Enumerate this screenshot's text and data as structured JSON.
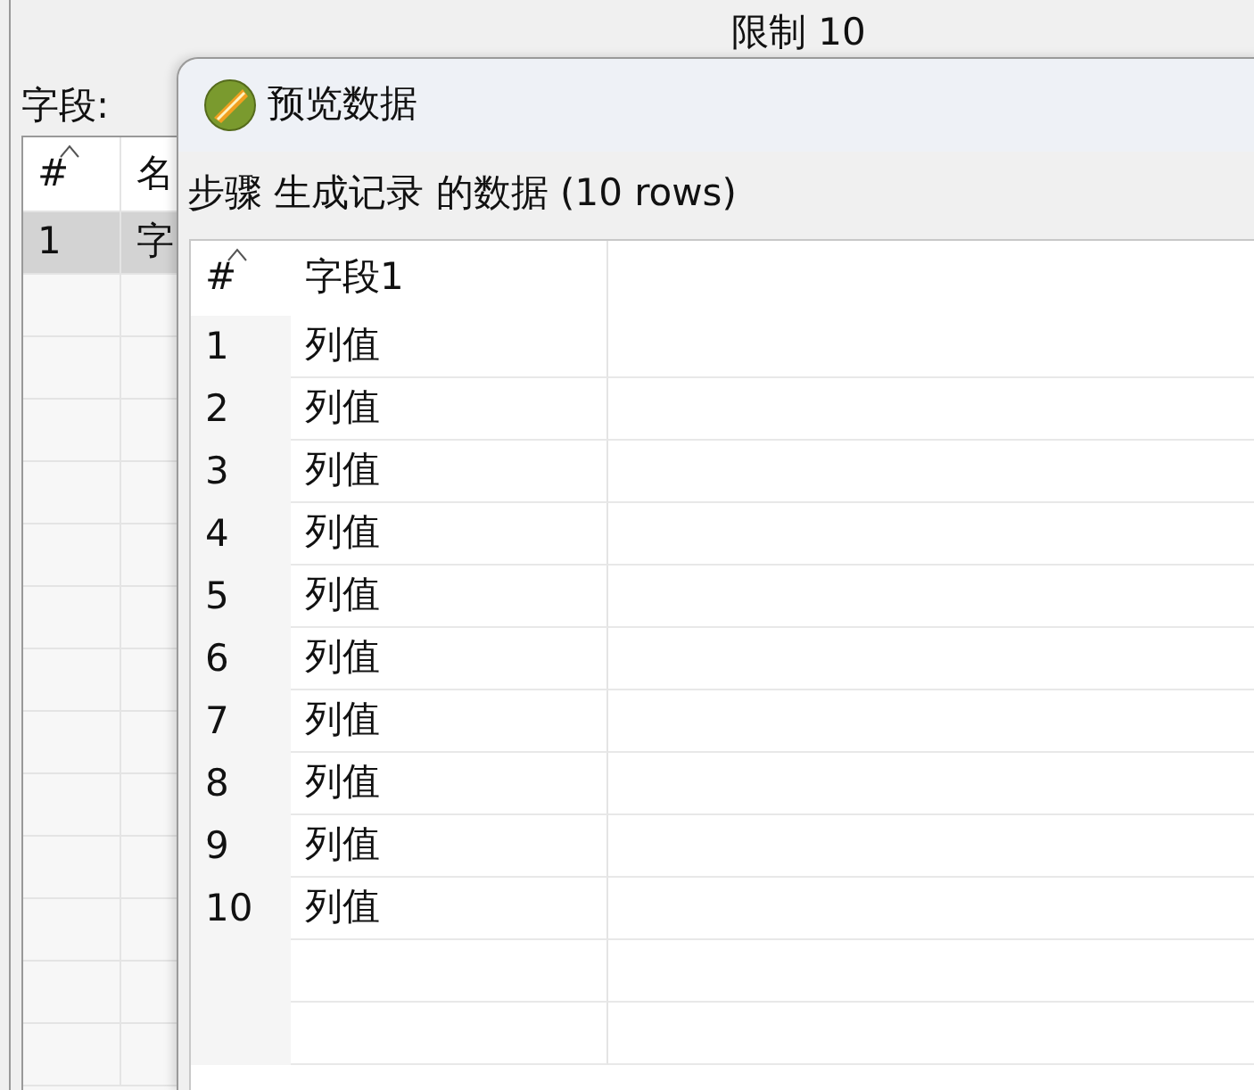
{
  "background": {
    "limit_label": "限制 10",
    "fields_label": "字段:",
    "table": {
      "columns": [
        "#",
        "名"
      ],
      "rows": [
        {
          "cells": [
            "1",
            "字"
          ],
          "selected": true
        }
      ]
    }
  },
  "dialog": {
    "title": "预览数据",
    "caption": "步骤 生成记录 的数据 (10 rows)",
    "table": {
      "columns": [
        "#",
        "字段1"
      ],
      "rows": [
        {
          "cells": [
            "1",
            "列值"
          ],
          "selected": false
        },
        {
          "cells": [
            "2",
            "列值"
          ],
          "selected": false
        },
        {
          "cells": [
            "3",
            "列值"
          ],
          "selected": false
        },
        {
          "cells": [
            "4",
            "列值"
          ],
          "selected": false
        },
        {
          "cells": [
            "5",
            "列值"
          ],
          "selected": false
        },
        {
          "cells": [
            "6",
            "列值"
          ],
          "selected": false
        },
        {
          "cells": [
            "7",
            "列值"
          ],
          "selected": false
        },
        {
          "cells": [
            "8",
            "列值"
          ],
          "selected": false
        },
        {
          "cells": [
            "9",
            "列值"
          ],
          "selected": false
        },
        {
          "cells": [
            "10",
            "列值"
          ],
          "selected": false
        }
      ]
    }
  }
}
